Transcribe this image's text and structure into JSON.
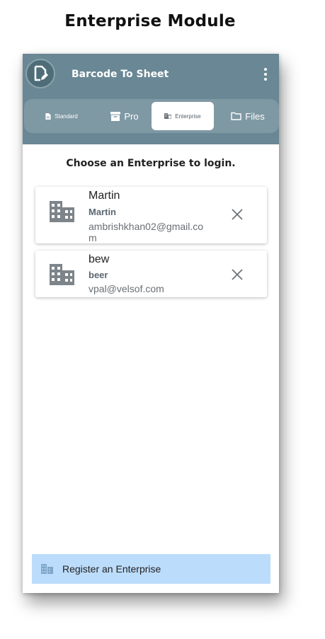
{
  "page_heading": "Enterprise Module",
  "app": {
    "title": "Barcode To Sheet"
  },
  "tabs": [
    {
      "label": "Standard",
      "icon": "document-icon",
      "active": false
    },
    {
      "label": "Pro",
      "icon": "archive-box-icon",
      "active": false
    },
    {
      "label": "Enterprise",
      "icon": "building-icon",
      "active": true
    },
    {
      "label": "Files",
      "icon": "folder-icon",
      "active": false
    }
  ],
  "prompt": "Choose an Enterprise to login.",
  "enterprises": [
    {
      "name": "Martin",
      "subtitle": "Martin",
      "email": "ambrishkhan02@gmail.com"
    },
    {
      "name": "bew",
      "subtitle": "beer",
      "email": "vpal@velsof.com"
    }
  ],
  "register": {
    "label": "Register an Enterprise",
    "icon": "building-icon"
  },
  "colors": {
    "appbar": "#698794",
    "tabbar": "#7f99a4",
    "register_bg": "#bcdcfb",
    "icon_gray": "#7d848a"
  }
}
